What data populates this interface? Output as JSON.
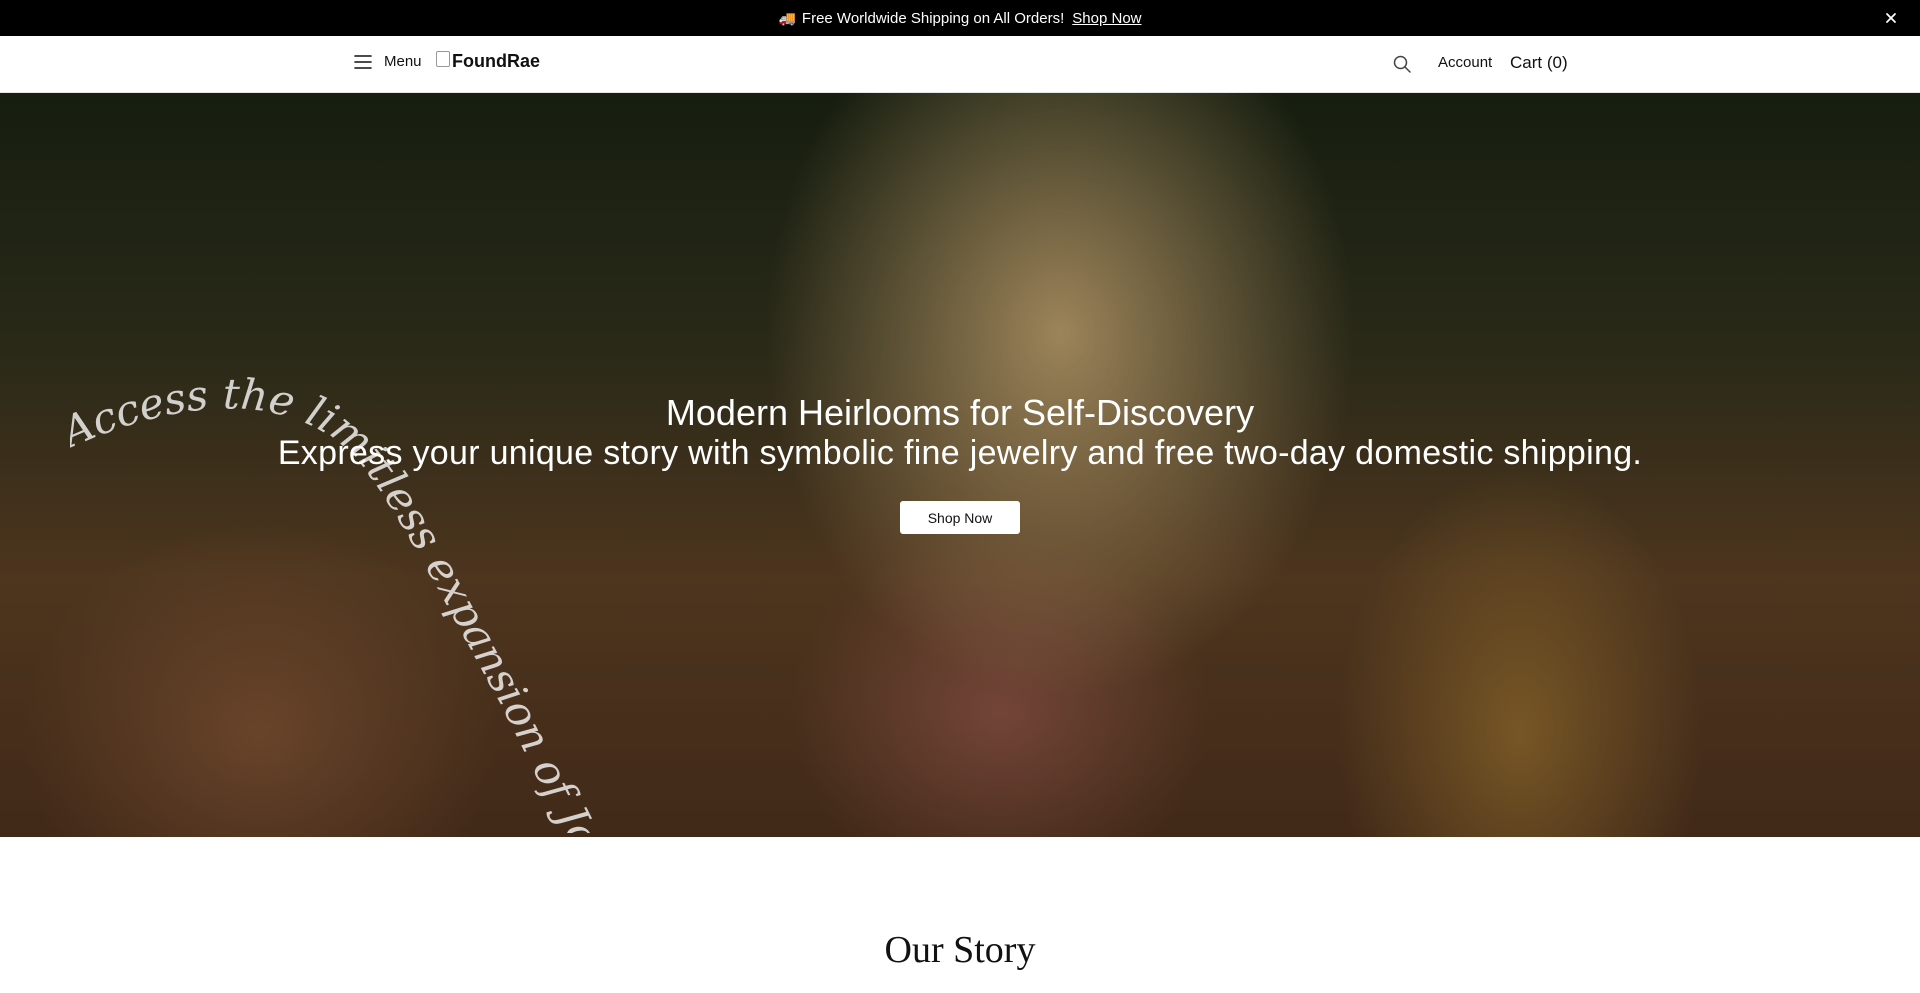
{
  "announcement": {
    "truck_icon": "🚚",
    "text": "Free Worldwide Shipping on All Orders!",
    "link_label": "Shop Now",
    "close_icon": "close-icon"
  },
  "header": {
    "menu_label": "Menu",
    "logo_alt": "FoundRae",
    "account_label": "Account",
    "cart_label": "Cart (0)",
    "search_icon": "search-icon"
  },
  "hero": {
    "script_text": "Access the limitless expansion of Joy an",
    "title": "Modern Heirlooms for Self-Discovery",
    "subtitle": "Express your unique story with symbolic fine jewelry and free two-day domestic shipping.",
    "button_label": "Shop Now"
  },
  "story": {
    "title": "Our Story"
  }
}
